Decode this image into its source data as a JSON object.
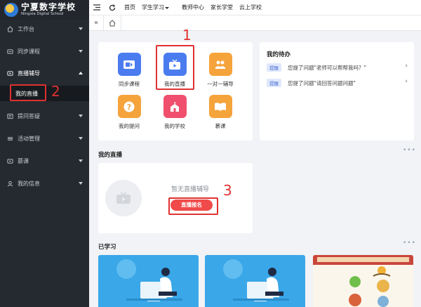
{
  "logo": {
    "name": "宁夏数字学校",
    "subtitle": "Ningxia Digital School"
  },
  "sidebar": {
    "items": [
      {
        "label": "工作台",
        "icon": "home-icon"
      },
      {
        "label": "同步课程",
        "icon": "course-icon"
      },
      {
        "label": "直播辅导",
        "icon": "live-icon",
        "expanded": true
      },
      {
        "label": "提问答疑",
        "icon": "question-icon"
      },
      {
        "label": "活动管理",
        "icon": "activity-icon"
      },
      {
        "label": "慕课",
        "icon": "mooc-icon"
      },
      {
        "label": "我的信息",
        "icon": "user-icon"
      }
    ],
    "sub_item": {
      "label": "我的直播"
    }
  },
  "topbar": {
    "menu": [
      "首页",
      "学生学习",
      "教师中心",
      "家长学堂",
      "云上学校"
    ]
  },
  "apps": [
    {
      "label": "同步课程",
      "icon": "sync-course-icon",
      "color": "#4a7cf0"
    },
    {
      "label": "我的直播",
      "icon": "my-live-icon",
      "color": "#4a7cf0"
    },
    {
      "label": "一对一辅导",
      "icon": "tutor-icon",
      "color": "#f5a33b"
    },
    {
      "label": "我的提问",
      "icon": "my-question-icon",
      "color": "#f5a33b"
    },
    {
      "label": "我的学校",
      "icon": "school-icon",
      "color": "#f0506e"
    },
    {
      "label": "慕课",
      "icon": "mooc-book-icon",
      "color": "#f5a33b"
    }
  ],
  "todo": {
    "title": "我的待办",
    "items": [
      {
        "badge": "提醒",
        "text": "您提了问题\"老师可以帮帮我吗？\""
      },
      {
        "badge": "提醒",
        "text": "您提了问题\"请回答问题问题\""
      }
    ]
  },
  "live": {
    "title": "我的直播",
    "empty_text": "暂无直播辅导",
    "signup_button": "直播报名"
  },
  "study": {
    "title": "已学习"
  },
  "annotations": [
    "1",
    "2",
    "3"
  ],
  "colors": {
    "sidebar_bg": "#252a30",
    "accent_red": "#e03131",
    "primary_blue": "#4a7cf0"
  }
}
